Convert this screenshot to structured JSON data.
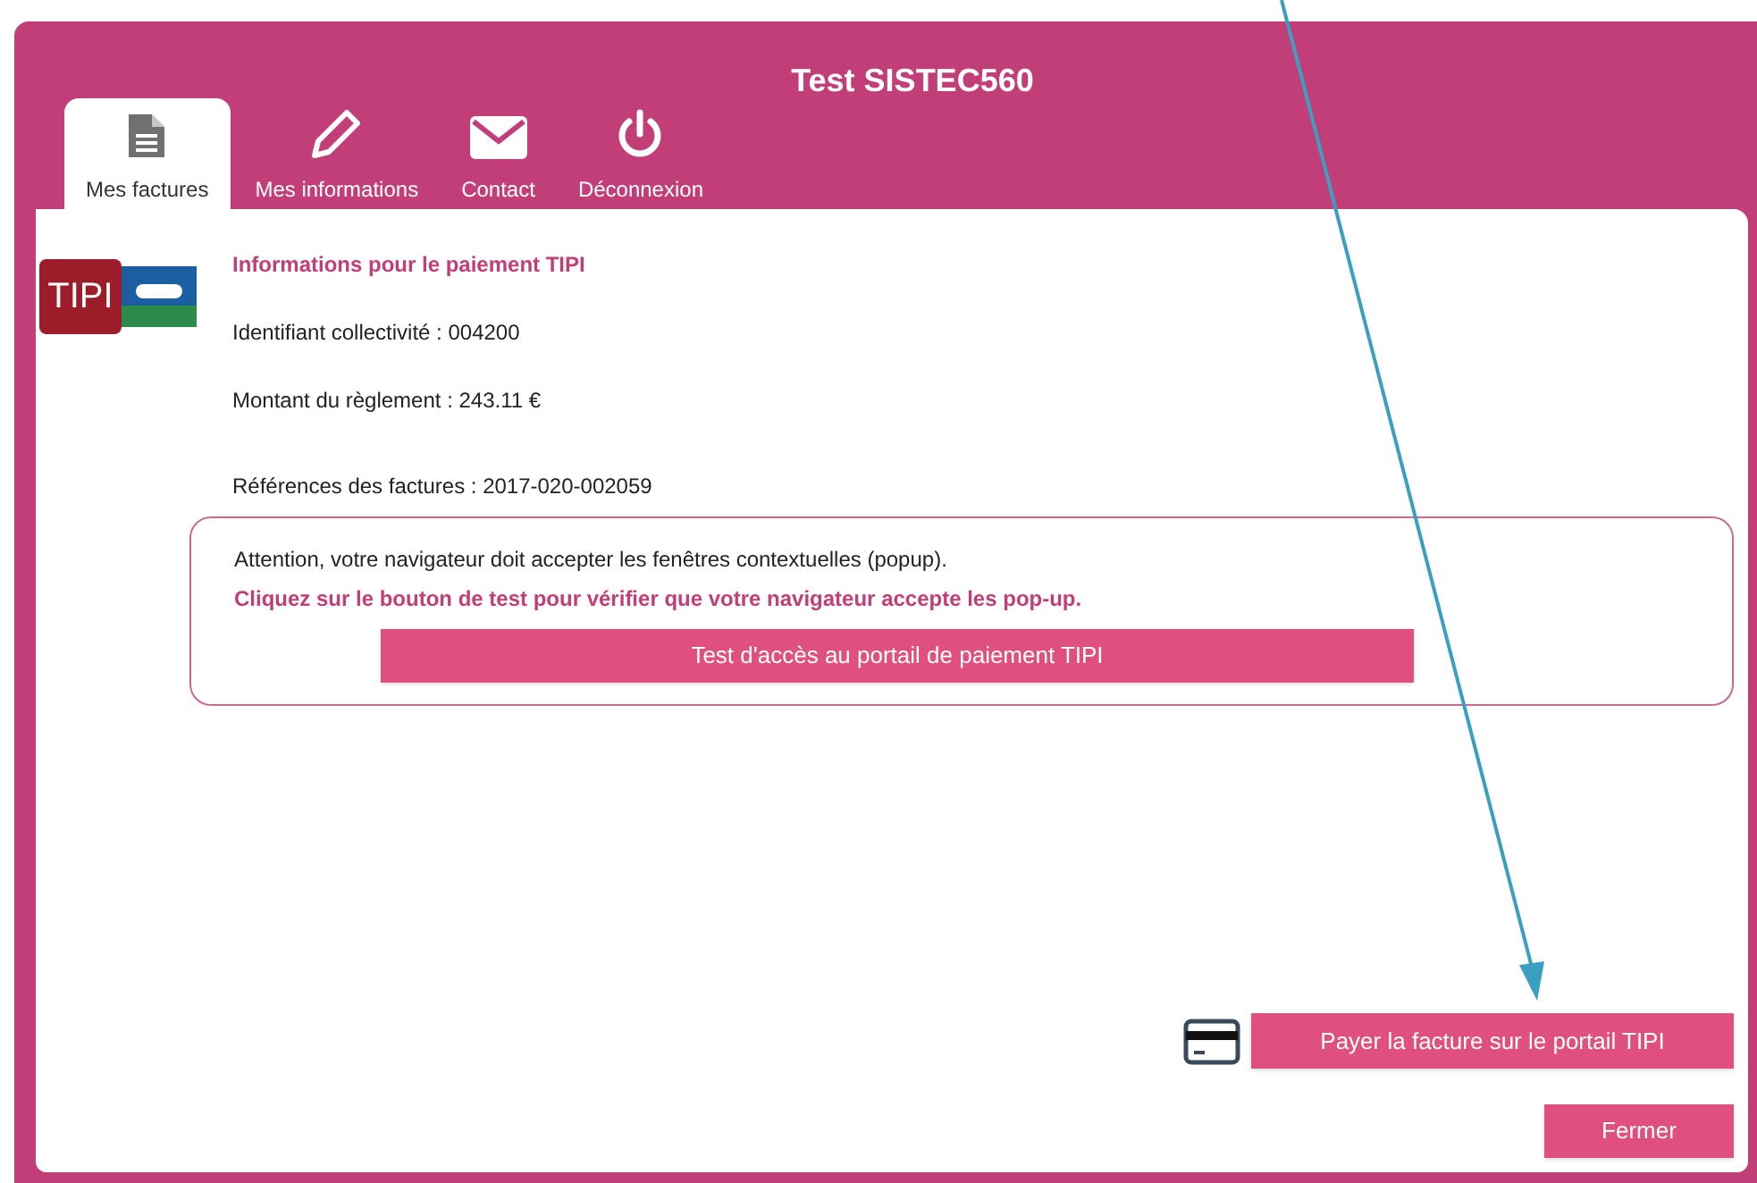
{
  "window": {
    "title": "Test SISTEC560"
  },
  "tabs": [
    {
      "label": "Mes factures",
      "kind": "document",
      "selected": true
    },
    {
      "label": "Mes informations",
      "kind": "pencil",
      "selected": false
    },
    {
      "label": "Contact",
      "kind": "mail",
      "selected": false
    },
    {
      "label": "Déconnexion",
      "kind": "power",
      "selected": false
    }
  ],
  "logo": {
    "text": "TIPI"
  },
  "info": {
    "heading": "Informations pour le paiement TIPI",
    "lines": [
      "Identifiant collectivité : 004200",
      "Montant du règlement : 243.11 €",
      "Références des factures : 2017-020-002059"
    ]
  },
  "notice": {
    "text": "Attention, votre navigateur doit accepter les fenêtres contextuelles (popup).",
    "emphasis": "Cliquez sur le bouton de test pour vérifier que votre navigateur accepte les pop-up.",
    "button": "Test d'accès au portail de paiement TIPI"
  },
  "pay_button": "Payer la facture sur le portail TIPI",
  "close_button": "Fermer"
}
